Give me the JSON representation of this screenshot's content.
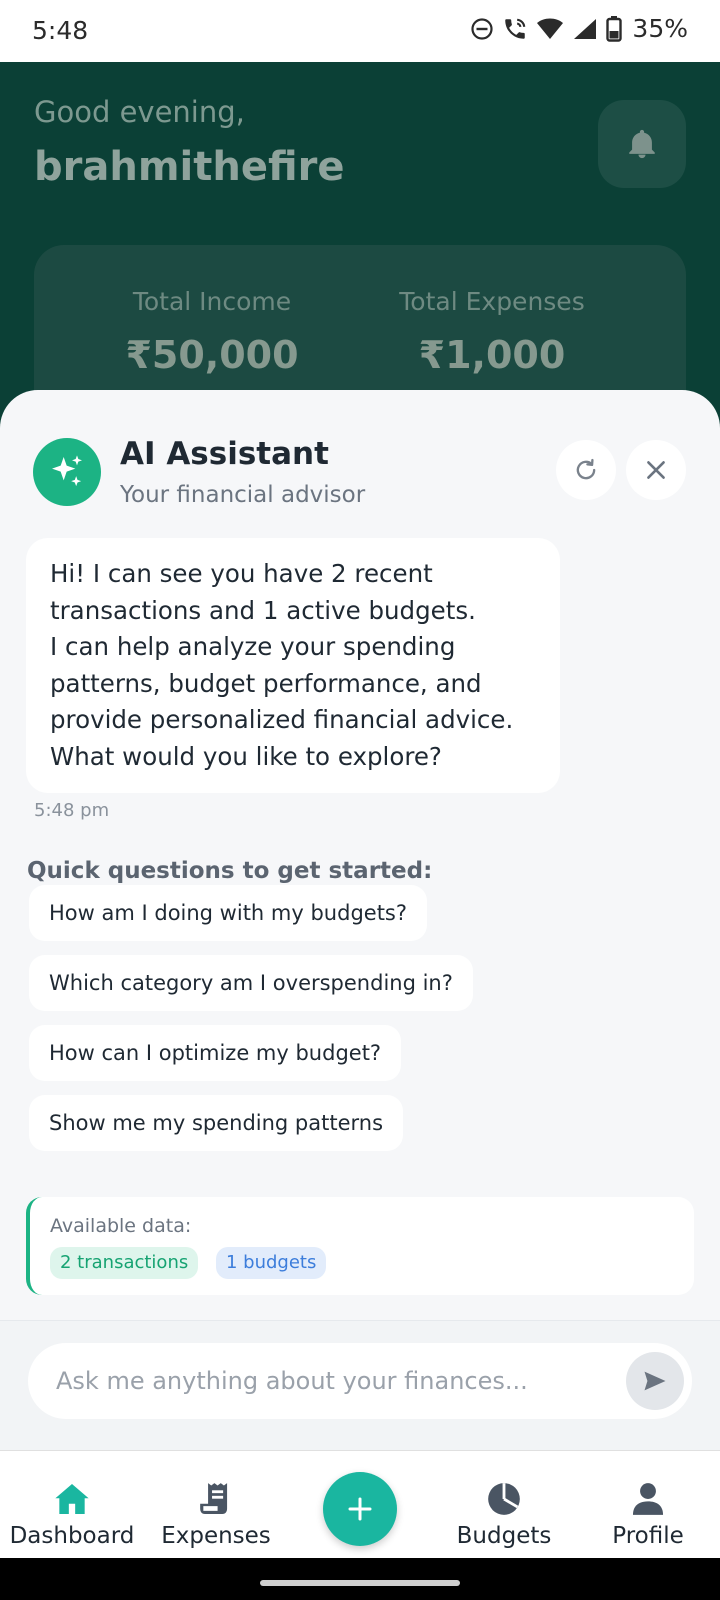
{
  "status_bar": {
    "time": "5:48",
    "battery": "35%"
  },
  "dashboard": {
    "greeting": "Good evening,",
    "username": "brahmithefire",
    "income_label": "Total Income",
    "income_value": "₹50,000",
    "expenses_label": "Total Expenses",
    "expenses_value": "₹1,000"
  },
  "assistant": {
    "title": "AI Assistant",
    "subtitle": "Your financial advisor",
    "message_lines": [
      "Hi! I can see you have 2 recent",
      "transactions and 1 active budgets.",
      "I can help analyze your spending",
      "patterns, budget performance, and",
      "provide personalized financial advice.",
      "What would you like to explore?"
    ],
    "message_time": "5:48 pm",
    "quick_title": "Quick questions to get started:",
    "quick_questions": [
      "How am I doing with my budgets?",
      "Which category am I overspending in?",
      "How can I optimize my budget?",
      "Show me my spending patterns"
    ],
    "available_label": "Available data:",
    "tag_transactions": "2 transactions",
    "tag_budgets": "1 budgets",
    "input_placeholder": "Ask me anything about your finances..."
  },
  "nav": {
    "items": [
      "Dashboard",
      "Expenses",
      "Budgets",
      "Profile"
    ]
  },
  "colors": {
    "brand": "#1cb384",
    "fab": "#1ab6a0",
    "dash_bg": "#0b4036"
  },
  "icons": {
    "header_bell": "bell-icon",
    "avatar": "sparkles-icon",
    "refresh": "refresh-icon",
    "close": "close-icon",
    "send": "send-icon",
    "nav": [
      "home-icon",
      "receipt-icon",
      "plus-icon",
      "pie-chart-icon",
      "user-icon"
    ]
  }
}
